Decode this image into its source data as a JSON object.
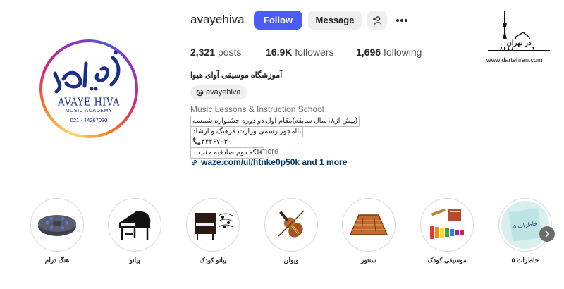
{
  "profile": {
    "username": "avayehiva",
    "follow_label": "Follow",
    "message_label": "Message",
    "add_user_icon": "person-add-icon",
    "more_icon": "more-dots-icon",
    "stats": {
      "posts_value": "2,321",
      "posts_label": "posts",
      "followers_value": "16.9K",
      "followers_label": "followers",
      "following_value": "1,696",
      "following_label": "following"
    },
    "bio_name": "آموزشگاه موسیقی آوای هیوا",
    "threads_handle": "avayehiva",
    "category": "Music Lessons & Instruction School",
    "bio_lines": [
      "(بیش از۱۸سال سابقه)مقام اول دو دوره جشنواره شمسه",
      "باامجوز رسمی وزارت فرهنگ و ارشاد",
      "۴۴۲۶۷۰۳۰📞",
      "قلکه دوم صادقیه جنب..."
    ],
    "more_label": "more",
    "link_text": "waze.com/ul/htnke0p50k and 1 more"
  },
  "avatar": {
    "script_text": "آوای هیوا",
    "name": "AVAYE HIVA",
    "sub": "MUSIC ACADEMY",
    "phone": "021 - 44267030"
  },
  "watermark": {
    "title": "در تهران",
    "url": "www.dartehran.com"
  },
  "highlights": [
    {
      "label": "هنگ درام",
      "icon": "handpan-icon"
    },
    {
      "label": "پیانو",
      "icon": "grand-piano-icon"
    },
    {
      "label": "پیانو کودک",
      "icon": "kids-piano-icon"
    },
    {
      "label": "ویولن",
      "icon": "violin-icon"
    },
    {
      "label": "سنتور",
      "icon": "santur-icon"
    },
    {
      "label": "موسیقی کودک",
      "icon": "kids-instruments-icon"
    },
    {
      "label": "خاطرات ۵",
      "icon": "memories-icon",
      "inner_text": "خاطرات ۵"
    }
  ],
  "colors": {
    "follow_bg": "#4a5df9",
    "link": "#00376b",
    "logo_blue": "#1c2f86"
  }
}
